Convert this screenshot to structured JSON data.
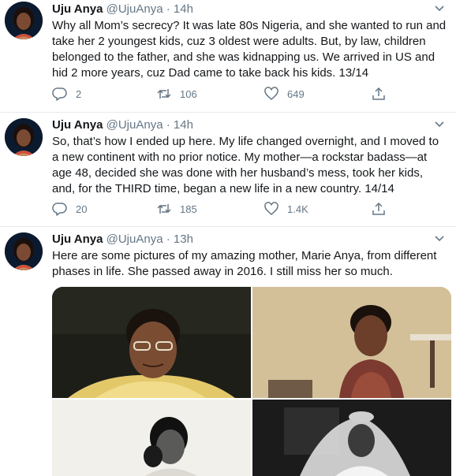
{
  "tweets": [
    {
      "name": "Uju Anya",
      "handle": "@UjuAnya",
      "separator": "·",
      "time": "14h",
      "text": "Why all Mom’s secrecy? It was late 80s Nigeria, and she wanted to run and take her 2 youngest kids, cuz 3 oldest were adults. But, by law, children belonged to the father, and she was kidnapping us. We arrived in US and hid 2 more years, cuz Dad came to take back his kids. 13/14",
      "replies": "2",
      "retweets": "106",
      "likes": "649"
    },
    {
      "name": "Uju Anya",
      "handle": "@UjuAnya",
      "separator": "·",
      "time": "14h",
      "text": "So, that’s how I ended up here. My life changed overnight, and I moved to a new continent with no prior notice. My mother—a rockstar badass—at age 48, decided she was done with her husband’s mess, took her kids, and, for the THIRD time, began a new life in a new country. 14/14",
      "replies": "20",
      "retweets": "185",
      "likes": "1.4K"
    },
    {
      "name": "Uju Anya",
      "handle": "@UjuAnya",
      "separator": "·",
      "time": "13h",
      "text": "Here are some pictures of my amazing mother, Marie Anya, from different phases in life. She passed away in 2016. I still miss her so much."
    }
  ],
  "icons": {
    "reply": "reply-icon",
    "retweet": "retweet-icon",
    "like": "heart-icon",
    "share": "share-icon",
    "more": "chevron-down-icon"
  },
  "colors": {
    "text": "#14171a",
    "secondary": "#657786",
    "divider": "#e6ecf0",
    "thread_line": "#ccd6dd"
  }
}
